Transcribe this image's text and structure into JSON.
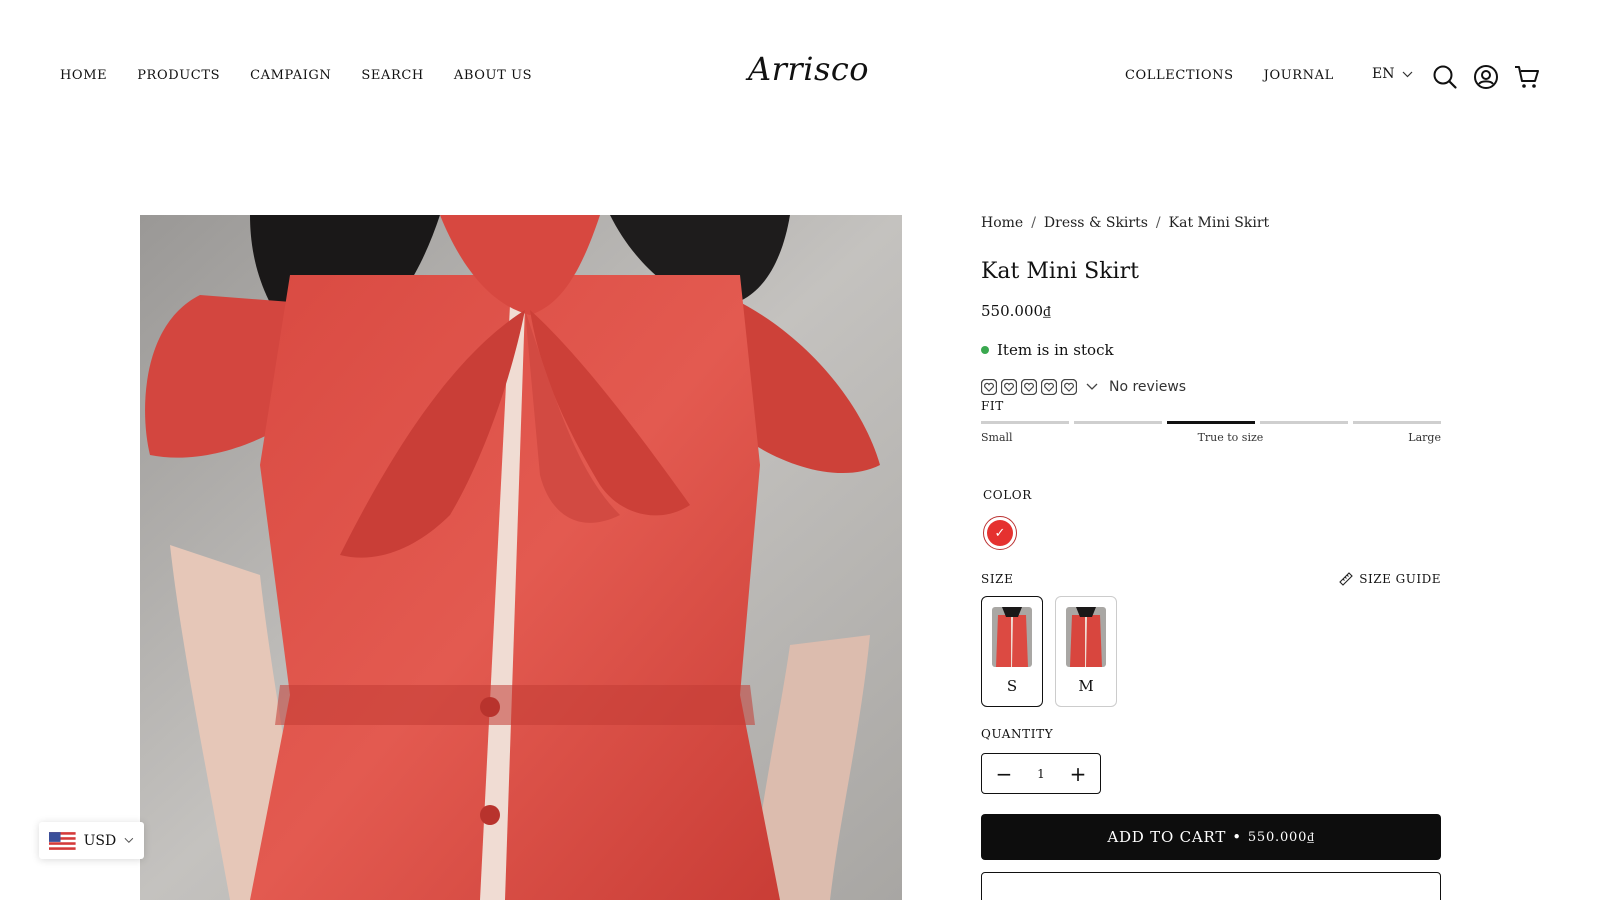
{
  "header": {
    "nav_left": [
      "HOME",
      "PRODUCTS",
      "CAMPAIGN",
      "SEARCH",
      "ABOUT US"
    ],
    "logo": "Arrisco",
    "nav_right": [
      "COLLECTIONS",
      "JOURNAL"
    ],
    "language": "EN",
    "icons": [
      "search-icon",
      "account-icon",
      "cart-icon"
    ]
  },
  "breadcrumb": [
    "Home",
    "Dress & Skirts",
    "Kat Mini Skirt"
  ],
  "breadcrumb_sep": "/",
  "product": {
    "title": "Kat Mini Skirt",
    "price": "550.000₫",
    "stock": "Item is in stock",
    "stock_color": "#3aa84f",
    "rating_value": 0,
    "rating_max": 5,
    "reviews": "No reviews"
  },
  "fit": {
    "label": "FIT",
    "selected_index": 2,
    "scale": [
      "Small",
      "True to size",
      "Large"
    ]
  },
  "color": {
    "label": "COLOR",
    "swatch": "#e5312f"
  },
  "size": {
    "label": "SIZE",
    "guide": "SIZE GUIDE",
    "options": [
      "S",
      "M"
    ],
    "selected": "S"
  },
  "quantity": {
    "label": "QUANTITY",
    "value": "1"
  },
  "cta": {
    "add_to_cart": "ADD TO CART",
    "bullet": "•",
    "price": "550.000₫"
  },
  "currency": {
    "code": "USD"
  }
}
